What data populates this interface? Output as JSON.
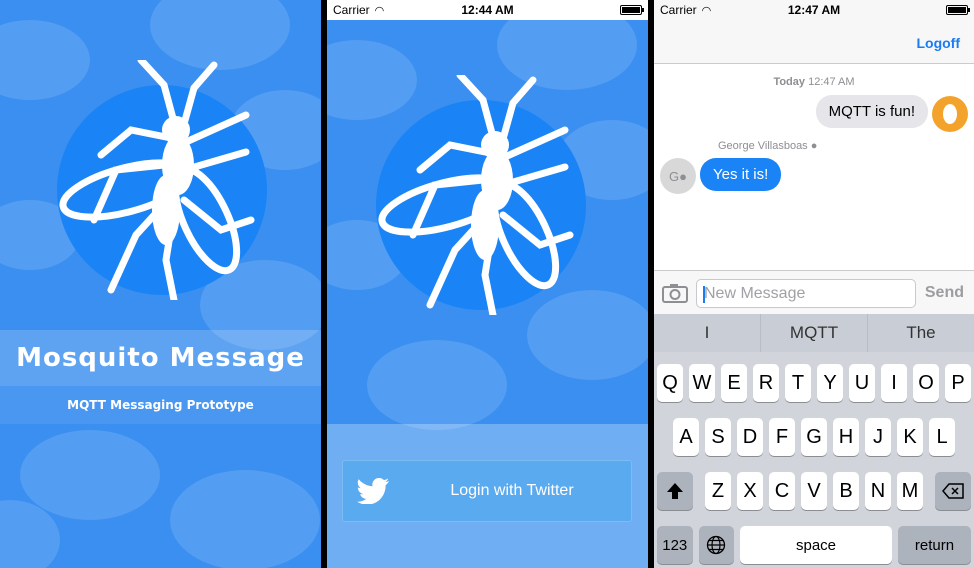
{
  "status_bars": [
    {
      "carrier": "",
      "time": ""
    },
    {
      "carrier": "Carrier",
      "time": "12:44 AM"
    },
    {
      "carrier": "Carrier",
      "time": "12:47 AM"
    }
  ],
  "splash": {
    "title": "Mosquito Message",
    "subtitle": "MQTT Messaging Prototype"
  },
  "login": {
    "button_label": "Login with Twitter",
    "button_icon": "twitter-bird-icon"
  },
  "chat": {
    "logoff_label": "Logoff",
    "timestamp_day": "Today",
    "timestamp_time": "12:47 AM",
    "outgoing_message": "MQTT is fun!",
    "incoming_sender": "George Villasboas",
    "incoming_avatar_initial": "G",
    "incoming_message": "Yes it is!",
    "input_placeholder": "New Message",
    "send_label": "Send",
    "colors": {
      "accent": "#1a7cf3",
      "incoming_bubble": "#1a84f6",
      "outgoing_bubble": "#e5e5ea"
    }
  },
  "keyboard": {
    "suggestions": [
      "I",
      "MQTT",
      "The"
    ],
    "row1": [
      "Q",
      "W",
      "E",
      "R",
      "T",
      "Y",
      "U",
      "I",
      "O",
      "P"
    ],
    "row2": [
      "A",
      "S",
      "D",
      "F",
      "G",
      "H",
      "J",
      "K",
      "L"
    ],
    "row3": [
      "Z",
      "X",
      "C",
      "V",
      "B",
      "N",
      "M"
    ],
    "numbers_label": "123",
    "space_label": "space",
    "return_label": "return"
  },
  "theme": {
    "brand_blue": "#3a8ff0",
    "logo_circle": "#1a84f6"
  }
}
